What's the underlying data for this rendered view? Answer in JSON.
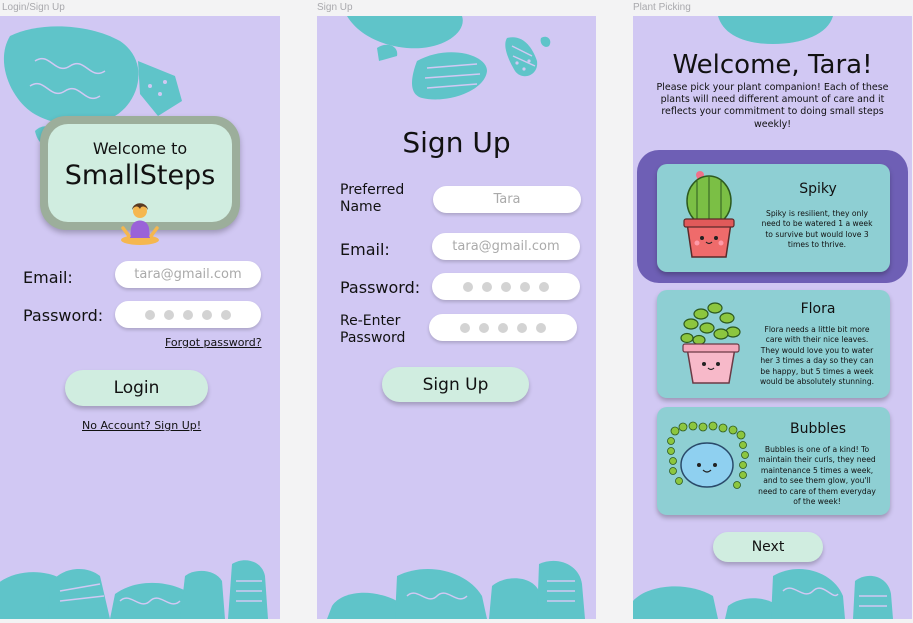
{
  "frames": {
    "login": {
      "frame_label": "Login/Sign Up",
      "welcome_line1": "Welcome to",
      "welcome_line2": "SmallSteps",
      "welcome_emoji": "🧘‍♀️",
      "email_label": "Email:",
      "email_value": "tara@gmail.com",
      "password_label": "Password:",
      "forgot_link": "Forgot password?",
      "login_button": "Login",
      "signup_link": "No Account? Sign Up!"
    },
    "signup": {
      "frame_label": "Sign Up",
      "title": "Sign Up",
      "name_label_1": "Preferred",
      "name_label_2": "Name",
      "name_value": "Tara",
      "email_label": "Email:",
      "email_value": "tara@gmail.com",
      "password_label": "Password:",
      "reenter_label_1": "Re-Enter",
      "reenter_label_2": "Password",
      "signup_button": "Sign Up"
    },
    "plant": {
      "frame_label": "Plant Picking",
      "title": "Welcome, Tara!",
      "intro": "Please pick your plant companion! Each of these plants will need different amount of care and it reflects your commitment to doing small steps weekly!",
      "cards": [
        {
          "name": "Spiky",
          "description": "Spiky is resilient, they only need to be watered 1 a week to survive but would love 3 times to thrive.",
          "selected": true
        },
        {
          "name": "Flora",
          "description": "Flora needs a little bit more care with their nice leaves. They would love you to water her 3 times a day so they can be happy, but 5 times a week would be absolutely stunning.",
          "selected": false
        },
        {
          "name": "Bubbles",
          "description": "Bubbles is one of a kind! To maintain their curls, they need maintenance 5 times a week, and to see them glow, you'll need to care of them everyday of the week!",
          "selected": false
        }
      ],
      "next_button": "Next"
    }
  },
  "colors": {
    "background": "#d1c8f3",
    "teal_shape": "#5fc4c9",
    "mint_button": "#d0ede0",
    "card_teal": "#8ecfd3",
    "selected_frame": "#6e5fb5"
  }
}
